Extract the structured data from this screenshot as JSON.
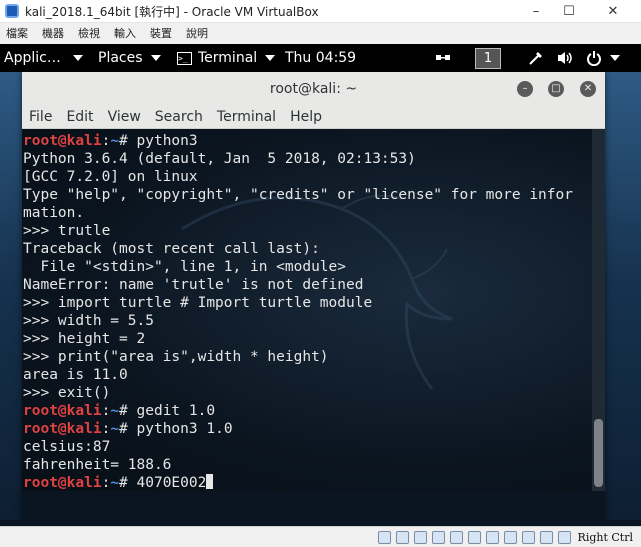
{
  "vbox": {
    "title": "kali_2018.1_64bit [執行中] - Oracle VM VirtualBox",
    "minimize": "–",
    "maximize": "☐",
    "close": "✕",
    "menu": [
      "檔案",
      "機器",
      "檢視",
      "輸入",
      "裝置",
      "說明"
    ],
    "host_key": "Right Ctrl"
  },
  "panel": {
    "applications": "Applic…",
    "places": "Places",
    "terminal": "Terminal",
    "clock": "Thu 04:59",
    "workspace": "1"
  },
  "terminal": {
    "title": "root@kali: ~",
    "menu": [
      "File",
      "Edit",
      "View",
      "Search",
      "Terminal",
      "Help"
    ],
    "prompt_user": "root@kali",
    "prompt_sep": ":",
    "prompt_path": "~",
    "prompt_end": "# ",
    "lines": [
      {
        "prompt": true,
        "text": "python3"
      },
      {
        "prompt": false,
        "text": "Python 3.6.4 (default, Jan  5 2018, 02:13:53)"
      },
      {
        "prompt": false,
        "text": "[GCC 7.2.0] on linux"
      },
      {
        "prompt": false,
        "text": "Type \"help\", \"copyright\", \"credits\" or \"license\" for more infor"
      },
      {
        "prompt": false,
        "text": "mation."
      },
      {
        "prompt": false,
        "text": ">>> trutle"
      },
      {
        "prompt": false,
        "text": "Traceback (most recent call last):"
      },
      {
        "prompt": false,
        "text": "  File \"<stdin>\", line 1, in <module>"
      },
      {
        "prompt": false,
        "text": "NameError: name 'trutle' is not defined"
      },
      {
        "prompt": false,
        "text": ">>> import turtle # Import turtle module"
      },
      {
        "prompt": false,
        "text": ">>> width = 5.5"
      },
      {
        "prompt": false,
        "text": ">>> height = 2"
      },
      {
        "prompt": false,
        "text": ">>> print(\"area is\",width * height)"
      },
      {
        "prompt": false,
        "text": "area is 11.0"
      },
      {
        "prompt": false,
        "text": ">>> exit()"
      },
      {
        "prompt": true,
        "text": "gedit 1.0"
      },
      {
        "prompt": true,
        "text": "python3 1.0"
      },
      {
        "prompt": false,
        "text": "celsius:87"
      },
      {
        "prompt": false,
        "text": "fahrenheit= 188.6"
      },
      {
        "prompt": true,
        "text": "4070E002",
        "cursor": true
      }
    ]
  },
  "colors": {
    "prompt_user": "#e04242",
    "prompt_path": "#4b8bd6",
    "terminal_text": "#e6e6e6",
    "panel_bg": "#000000"
  }
}
